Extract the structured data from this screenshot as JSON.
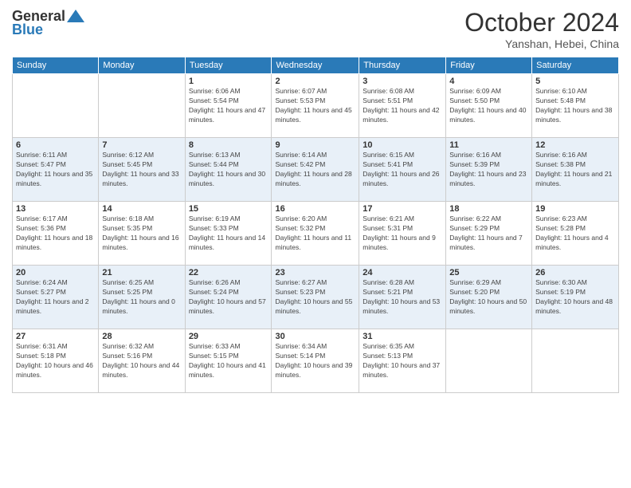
{
  "logo": {
    "general": "General",
    "blue": "Blue"
  },
  "title": {
    "month_year": "October 2024",
    "location": "Yanshan, Hebei, China"
  },
  "headers": [
    "Sunday",
    "Monday",
    "Tuesday",
    "Wednesday",
    "Thursday",
    "Friday",
    "Saturday"
  ],
  "weeks": [
    [
      {
        "day": "",
        "info": ""
      },
      {
        "day": "",
        "info": ""
      },
      {
        "day": "1",
        "info": "Sunrise: 6:06 AM\nSunset: 5:54 PM\nDaylight: 11 hours and 47 minutes."
      },
      {
        "day": "2",
        "info": "Sunrise: 6:07 AM\nSunset: 5:53 PM\nDaylight: 11 hours and 45 minutes."
      },
      {
        "day": "3",
        "info": "Sunrise: 6:08 AM\nSunset: 5:51 PM\nDaylight: 11 hours and 42 minutes."
      },
      {
        "day": "4",
        "info": "Sunrise: 6:09 AM\nSunset: 5:50 PM\nDaylight: 11 hours and 40 minutes."
      },
      {
        "day": "5",
        "info": "Sunrise: 6:10 AM\nSunset: 5:48 PM\nDaylight: 11 hours and 38 minutes."
      }
    ],
    [
      {
        "day": "6",
        "info": "Sunrise: 6:11 AM\nSunset: 5:47 PM\nDaylight: 11 hours and 35 minutes."
      },
      {
        "day": "7",
        "info": "Sunrise: 6:12 AM\nSunset: 5:45 PM\nDaylight: 11 hours and 33 minutes."
      },
      {
        "day": "8",
        "info": "Sunrise: 6:13 AM\nSunset: 5:44 PM\nDaylight: 11 hours and 30 minutes."
      },
      {
        "day": "9",
        "info": "Sunrise: 6:14 AM\nSunset: 5:42 PM\nDaylight: 11 hours and 28 minutes."
      },
      {
        "day": "10",
        "info": "Sunrise: 6:15 AM\nSunset: 5:41 PM\nDaylight: 11 hours and 26 minutes."
      },
      {
        "day": "11",
        "info": "Sunrise: 6:16 AM\nSunset: 5:39 PM\nDaylight: 11 hours and 23 minutes."
      },
      {
        "day": "12",
        "info": "Sunrise: 6:16 AM\nSunset: 5:38 PM\nDaylight: 11 hours and 21 minutes."
      }
    ],
    [
      {
        "day": "13",
        "info": "Sunrise: 6:17 AM\nSunset: 5:36 PM\nDaylight: 11 hours and 18 minutes."
      },
      {
        "day": "14",
        "info": "Sunrise: 6:18 AM\nSunset: 5:35 PM\nDaylight: 11 hours and 16 minutes."
      },
      {
        "day": "15",
        "info": "Sunrise: 6:19 AM\nSunset: 5:33 PM\nDaylight: 11 hours and 14 minutes."
      },
      {
        "day": "16",
        "info": "Sunrise: 6:20 AM\nSunset: 5:32 PM\nDaylight: 11 hours and 11 minutes."
      },
      {
        "day": "17",
        "info": "Sunrise: 6:21 AM\nSunset: 5:31 PM\nDaylight: 11 hours and 9 minutes."
      },
      {
        "day": "18",
        "info": "Sunrise: 6:22 AM\nSunset: 5:29 PM\nDaylight: 11 hours and 7 minutes."
      },
      {
        "day": "19",
        "info": "Sunrise: 6:23 AM\nSunset: 5:28 PM\nDaylight: 11 hours and 4 minutes."
      }
    ],
    [
      {
        "day": "20",
        "info": "Sunrise: 6:24 AM\nSunset: 5:27 PM\nDaylight: 11 hours and 2 minutes."
      },
      {
        "day": "21",
        "info": "Sunrise: 6:25 AM\nSunset: 5:25 PM\nDaylight: 11 hours and 0 minutes."
      },
      {
        "day": "22",
        "info": "Sunrise: 6:26 AM\nSunset: 5:24 PM\nDaylight: 10 hours and 57 minutes."
      },
      {
        "day": "23",
        "info": "Sunrise: 6:27 AM\nSunset: 5:23 PM\nDaylight: 10 hours and 55 minutes."
      },
      {
        "day": "24",
        "info": "Sunrise: 6:28 AM\nSunset: 5:21 PM\nDaylight: 10 hours and 53 minutes."
      },
      {
        "day": "25",
        "info": "Sunrise: 6:29 AM\nSunset: 5:20 PM\nDaylight: 10 hours and 50 minutes."
      },
      {
        "day": "26",
        "info": "Sunrise: 6:30 AM\nSunset: 5:19 PM\nDaylight: 10 hours and 48 minutes."
      }
    ],
    [
      {
        "day": "27",
        "info": "Sunrise: 6:31 AM\nSunset: 5:18 PM\nDaylight: 10 hours and 46 minutes."
      },
      {
        "day": "28",
        "info": "Sunrise: 6:32 AM\nSunset: 5:16 PM\nDaylight: 10 hours and 44 minutes."
      },
      {
        "day": "29",
        "info": "Sunrise: 6:33 AM\nSunset: 5:15 PM\nDaylight: 10 hours and 41 minutes."
      },
      {
        "day": "30",
        "info": "Sunrise: 6:34 AM\nSunset: 5:14 PM\nDaylight: 10 hours and 39 minutes."
      },
      {
        "day": "31",
        "info": "Sunrise: 6:35 AM\nSunset: 5:13 PM\nDaylight: 10 hours and 37 minutes."
      },
      {
        "day": "",
        "info": ""
      },
      {
        "day": "",
        "info": ""
      }
    ]
  ]
}
